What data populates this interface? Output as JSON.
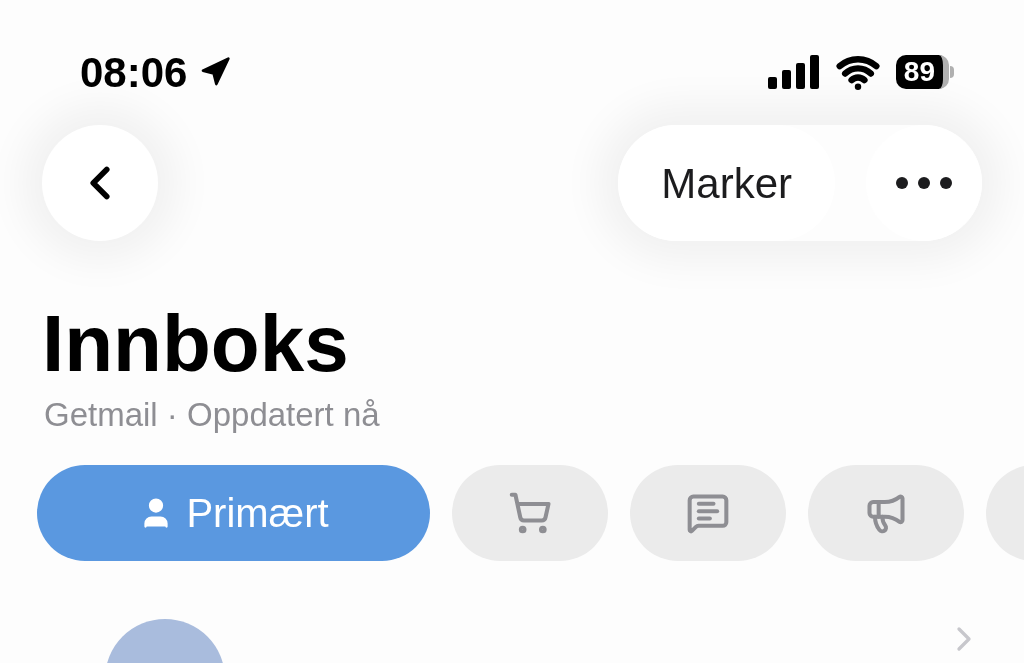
{
  "status_bar": {
    "time": "08:06",
    "battery": "89"
  },
  "nav": {
    "action_button": "Marker"
  },
  "title": "Innboks",
  "subtitle": "Getmail · Oppdatert nå",
  "filters": [
    {
      "kind": "primary",
      "label": "Primært",
      "selected": true
    },
    {
      "kind": "shopping",
      "selected": false
    },
    {
      "kind": "chat",
      "selected": false
    },
    {
      "kind": "promotions",
      "selected": false
    },
    {
      "kind": "other",
      "selected": false
    }
  ]
}
